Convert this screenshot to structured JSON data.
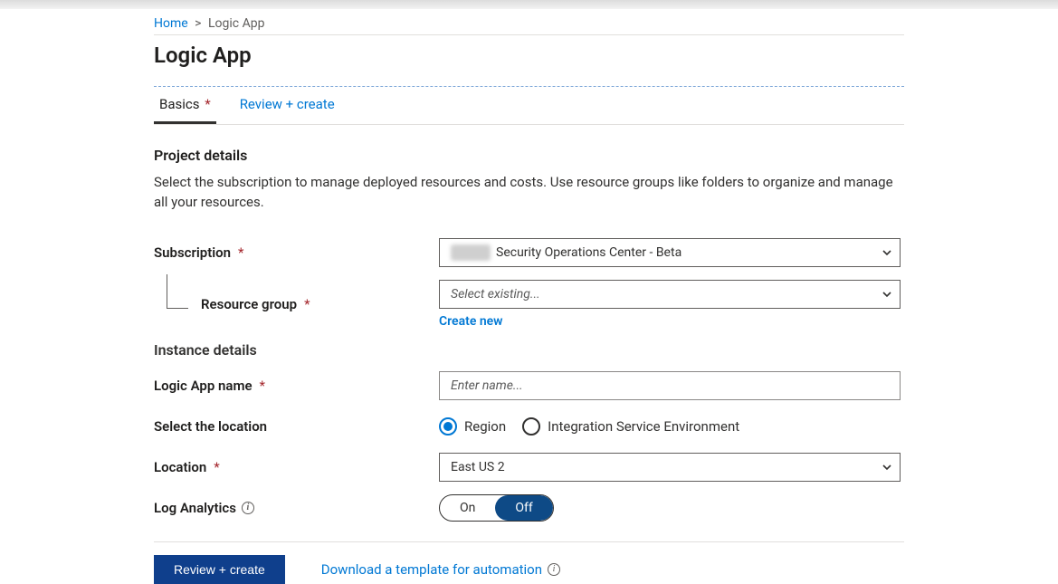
{
  "breadcrumb": {
    "home": "Home",
    "separator": ">",
    "current": "Logic App"
  },
  "title": "Logic App",
  "tabs": {
    "basics": "Basics",
    "review": "Review + create"
  },
  "project_details": {
    "heading": "Project details",
    "description": "Select the subscription to manage deployed resources and costs. Use resource groups like folders to organize and manage all your resources.",
    "subscription_label": "Subscription",
    "subscription_value": "Security Operations Center - Beta",
    "resource_group_label": "Resource group",
    "resource_group_placeholder": "Select existing...",
    "create_new": "Create new"
  },
  "instance_details": {
    "heading": "Instance details",
    "app_name_label": "Logic App name",
    "app_name_placeholder": "Enter name...",
    "select_location_label": "Select the location",
    "radio_region": "Region",
    "radio_ise": "Integration Service Environment",
    "location_label": "Location",
    "location_value": "East US 2",
    "log_analytics_label": "Log Analytics",
    "toggle_on": "On",
    "toggle_off": "Off"
  },
  "footer": {
    "review_create": "Review + create",
    "download_template": "Download a template for automation"
  }
}
